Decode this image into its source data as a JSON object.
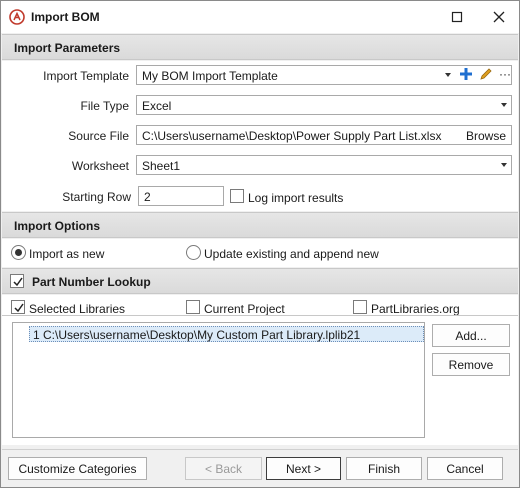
{
  "window": {
    "title": "Import BOM"
  },
  "sections": {
    "params": "Import Parameters",
    "options": "Import Options",
    "lookup": "Part Number Lookup"
  },
  "params": {
    "template_label": "Import Template",
    "template_value": "My BOM Import Template",
    "filetype_label": "File Type",
    "filetype_value": "Excel",
    "source_label": "Source File",
    "source_value": "C:\\Users\\username\\Desktop\\Power Supply Part List.xlsx",
    "browse_label": "Browse",
    "worksheet_label": "Worksheet",
    "worksheet_value": "Sheet1",
    "startrow_label": "Starting Row",
    "startrow_value": "2",
    "log_label": "Log import results",
    "log_checked": false
  },
  "options": {
    "import_new": "Import as new",
    "update_append": "Update existing and append new",
    "selected": "import_new"
  },
  "lookup": {
    "enabled": true,
    "selected_libraries": "Selected Libraries",
    "current_project": "Current Project",
    "partlibraries": "PartLibraries.org",
    "libraries": [
      "1  C:\\Users\\username\\Desktop\\My Custom Part Library.lplib21"
    ],
    "add_label": "Add...",
    "remove_label": "Remove"
  },
  "footer": {
    "customize": "Customize Categories",
    "back": "< Back",
    "next": "Next >",
    "finish": "Finish",
    "cancel": "Cancel"
  },
  "colors": {
    "brand_red": "#c0392b",
    "add_blue": "#1f6fd0",
    "edit_orange": "#e0a020"
  }
}
